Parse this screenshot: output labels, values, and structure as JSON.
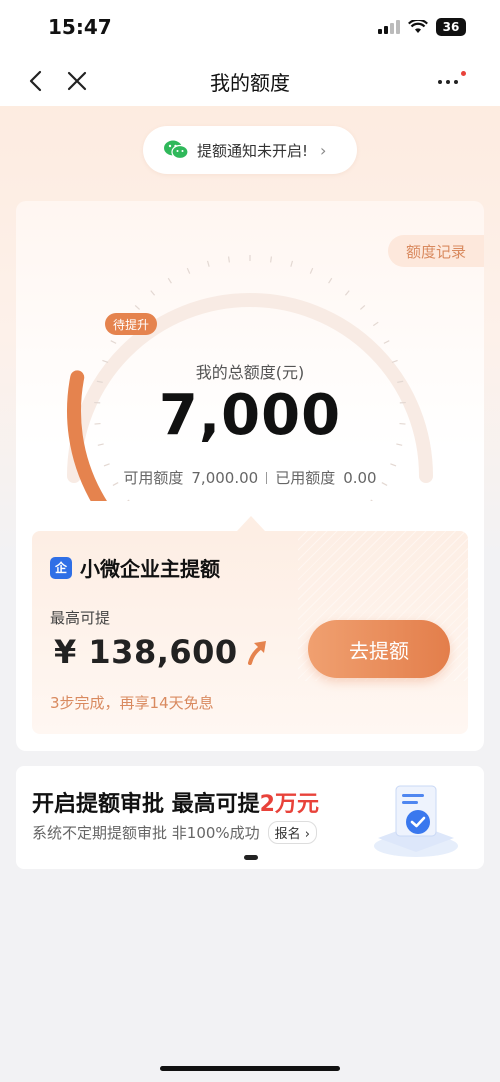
{
  "status": {
    "time": "15:47",
    "battery": "36"
  },
  "nav": {
    "title": "我的额度"
  },
  "notify": {
    "text": "提额通知未开启!"
  },
  "card": {
    "record_tab": "额度记录",
    "badge": "待提升",
    "total_label": "我的总额度(元)",
    "total_value": "7,000",
    "available_label": "可用额度",
    "available_value": "7,000.00",
    "used_label": "已用额度",
    "used_value": "0.00",
    "gauge_fill_fraction": 0.25
  },
  "promo": {
    "icon_text": "企",
    "title": "小微企业主提额",
    "max_label": "最高可提",
    "max_amount": "¥ 138,600",
    "note": "3步完成，再享14天免息",
    "button": "去提额"
  },
  "banner": {
    "title_prefix": "开启提额审批 最高可提",
    "title_highlight": "2万元",
    "subtitle": "系统不定期提额审批 非100%成功",
    "signup": "报名"
  },
  "colors": {
    "accent": "#e5834e",
    "highlight": "#e8423a",
    "promo_note": "#d98a5f"
  }
}
